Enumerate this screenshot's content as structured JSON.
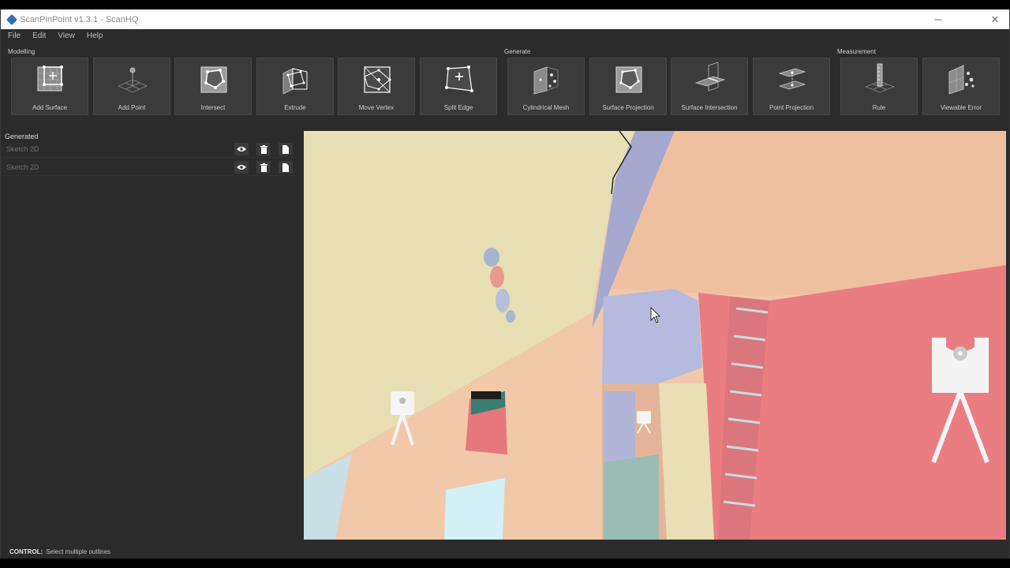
{
  "titlebar": {
    "title": "ScanPinPoint v1.3.1 - ScanHQ",
    "minimize_glyph": "─",
    "close_glyph": "✕"
  },
  "menu": [
    "File",
    "Edit",
    "View",
    "Help"
  ],
  "ribbon": {
    "groups": {
      "modelling": "Modelling",
      "generate": "Generate",
      "measurement": "Measurement"
    },
    "tools": [
      {
        "label": "Add Surface",
        "icon": "add-surface-icon"
      },
      {
        "label": "Add Point",
        "icon": "add-point-icon"
      },
      {
        "label": "Intersect",
        "icon": "intersect-icon"
      },
      {
        "label": "Extrude",
        "icon": "extrude-icon"
      },
      {
        "label": "Move Vertex",
        "icon": "move-vertex-icon"
      },
      {
        "label": "Split Edge",
        "icon": "split-edge-icon"
      },
      {
        "label": "Cylindrical Mesh",
        "icon": "cylindrical-mesh-icon"
      },
      {
        "label": "Surface Projection",
        "icon": "surface-projection-icon"
      },
      {
        "label": "Surface Intersection",
        "icon": "surface-intersection-icon"
      },
      {
        "label": "Point Projection",
        "icon": "point-projection-icon"
      },
      {
        "label": "Rule",
        "icon": "rule-icon"
      },
      {
        "label": "Viewable Error",
        "icon": "viewable-error-icon"
      }
    ]
  },
  "layers": {
    "title": "Generated",
    "items": [
      {
        "name": "Sketch 2D"
      },
      {
        "name": "Sketch 2D"
      }
    ]
  },
  "statusbar": {
    "key": "CONTROL:",
    "text": "Select multiple outlines"
  },
  "colors": {
    "window_bg": "#2b2b2b",
    "button_bg": "#3b3b3b",
    "wall_yellow": "#e8e0b4",
    "wall_peach": "#f2c6a8",
    "wall_red": "#ea7c80",
    "floor_blue": "#b8bde0",
    "scanner_white": "#f4f4f4"
  }
}
